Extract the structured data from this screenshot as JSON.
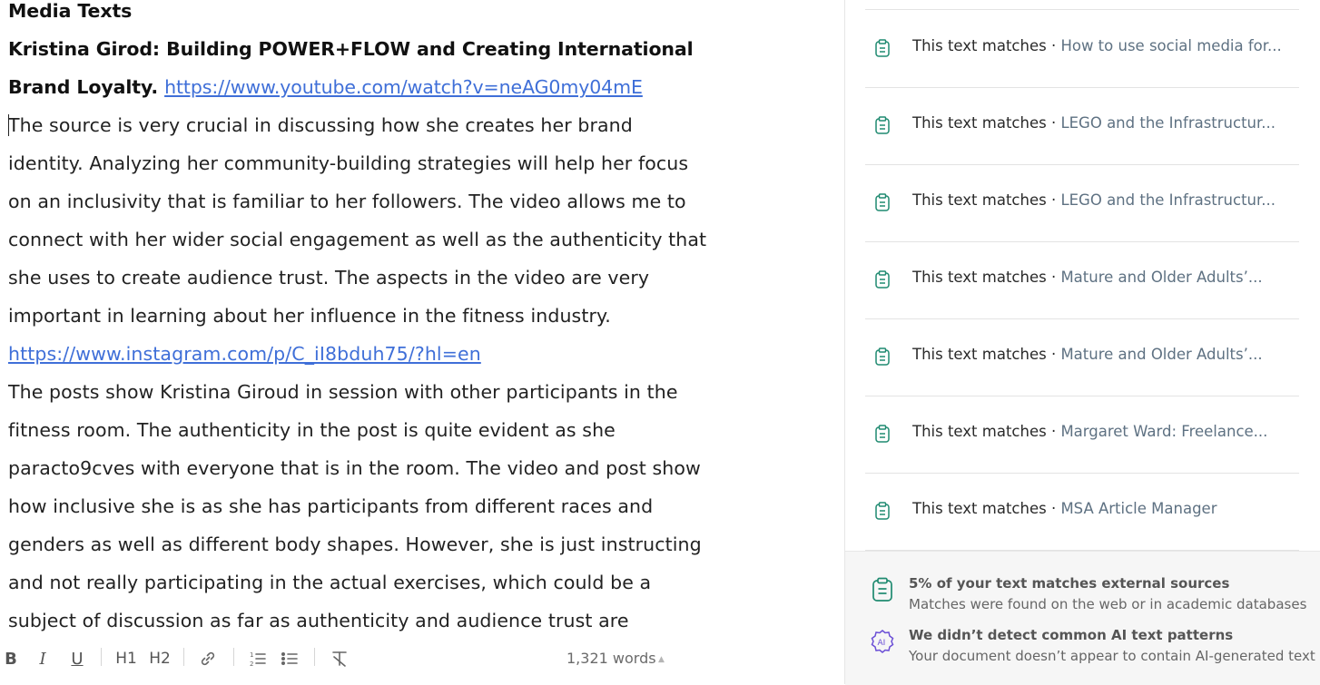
{
  "document": {
    "lines": [
      {
        "text": "Media Texts",
        "style": "bold"
      },
      {
        "text": "Kristina Girod: Building POWER+FLOW and Creating International",
        "style": "bold"
      },
      {
        "text": "Brand Loyalty.",
        "style": "bold",
        "link": "https://www.youtube.com/watch?v=neAG0my04mE"
      },
      {
        "text": "The source is very crucial in discussing how she creates her brand",
        "caret": true
      },
      {
        "text": "identity. Analyzing her community-building strategies will help her focus"
      },
      {
        "text": "on an inclusivity that is familiar to her followers. The video allows me to"
      },
      {
        "text": "connect with her wider social engagement as well as the authenticity that"
      },
      {
        "text": "she uses to create audience trust. The aspects in the video are very"
      },
      {
        "text": "important in learning about her influence in the fitness industry."
      },
      {
        "link_only": "https://www.instagram.com/p/C_iI8bduh75/?hl=en"
      },
      {
        "text": "The posts show Kristina Giroud in session with other participants in the"
      },
      {
        "text": "fitness room. The authenticity in the post is quite evident as she"
      },
      {
        "text": "paracto9cves with everyone that is in the room. The video and post show"
      },
      {
        "text": "how inclusive she is as she has participants from different races and"
      },
      {
        "text": "genders as well as different body shapes. However, she is just instructing"
      },
      {
        "text": "and not really participating in the actual exercises, which could be a"
      },
      {
        "text": "subject of discussion as far as authenticity and audience trust are"
      }
    ]
  },
  "toolbar": {
    "bold": "B",
    "italic": "I",
    "underline": "U",
    "h1": "H1",
    "h2": "H2",
    "word_count": "1,321 words"
  },
  "panel": {
    "matches": [
      {
        "prefix": "This text matches · ",
        "source": "How to use social media for..."
      },
      {
        "prefix": "This text matches · ",
        "source": "LEGO and the Infrastructur..."
      },
      {
        "prefix": "This text matches · ",
        "source": "LEGO and the Infrastructur..."
      },
      {
        "prefix": "This text matches · ",
        "source": "Mature and Older Adults’..."
      },
      {
        "prefix": "This text matches · ",
        "source": "Mature and Older Adults’..."
      },
      {
        "prefix": "This text matches · ",
        "source": "Margaret Ward: Freelance..."
      },
      {
        "prefix": "This text matches · ",
        "source": "MSA Article Manager"
      }
    ],
    "plagiarism": {
      "title": "5% of your text matches external sources",
      "subtitle": "Matches were found on the web or in academic databases"
    },
    "ai_detection": {
      "title": "We didn’t detect common AI text patterns",
      "subtitle": "Your document doesn’t appear to contain AI-generated text",
      "icon_label": "AI"
    }
  },
  "colors": {
    "link": "#3f6fd8",
    "match_icon": "#1f8a70",
    "ai_icon": "#6b4fd6",
    "source_text": "#5e7182"
  }
}
